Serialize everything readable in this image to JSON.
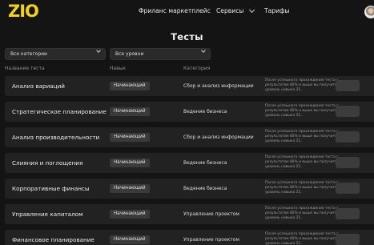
{
  "header": {
    "logo_text": "ZIO",
    "nav": {
      "freelance": "Фриланс маркетплейс",
      "services": "Сервисы",
      "pricing": "Тарифы"
    }
  },
  "page_title": "Тесты",
  "filters": {
    "category": "Все категории",
    "level": "Все уровни"
  },
  "columns": {
    "name": "Название теста",
    "skills": "Навык",
    "category": "Категория"
  },
  "note_text": "После успешного прохождения теста с результатом 80% и выше вы получите уровень навыка Z1.",
  "rows": [
    {
      "name": "Анализ вариаций",
      "level": "Начинающий",
      "category": "Сбор и анализ информации"
    },
    {
      "name": "Стратегическое планирование",
      "level": "Начинающий",
      "category": "Ведение бизнеса"
    },
    {
      "name": "Анализ производительности",
      "level": "Начинающий",
      "category": "Сбор и анализ информации"
    },
    {
      "name": "Слияния и поглощения",
      "level": "Начинающий",
      "category": "Ведение бизнеса"
    },
    {
      "name": "Корпоративные финансы",
      "level": "Начинающий",
      "category": "Ведение бизнеса"
    },
    {
      "name": "Управление капиталом",
      "level": "Начинающий",
      "category": "Управление проектом"
    },
    {
      "name": "Финансовое планирование",
      "level": "Начинающий",
      "category": "Управление проектом"
    }
  ],
  "colors": {
    "background": "#141414",
    "row": "#222222",
    "logo_yellow": "#f2d022"
  }
}
